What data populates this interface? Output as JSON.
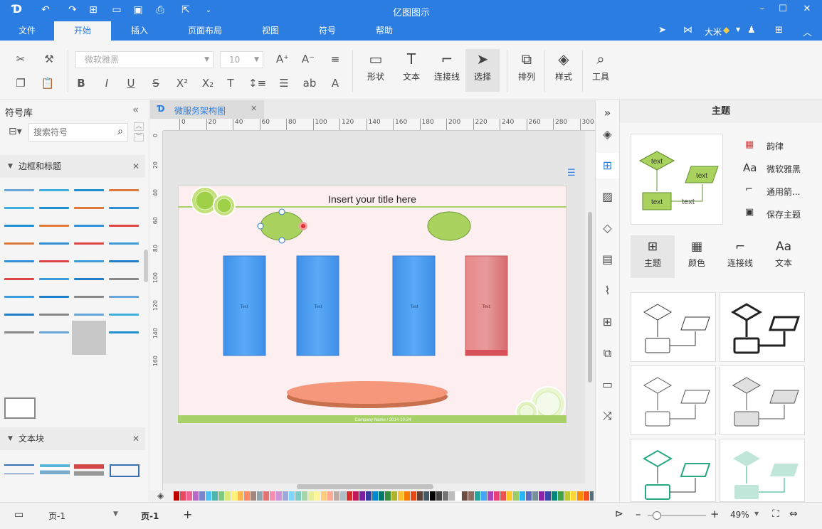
{
  "app": {
    "title": "亿图图示"
  },
  "menu": {
    "file": "文件",
    "tabs": [
      "开始",
      "插入",
      "页面布局",
      "视图",
      "符号",
      "帮助"
    ]
  },
  "user": {
    "name": "大米"
  },
  "ribbon": {
    "font_family": "微软雅黑",
    "font_size": "10",
    "shape_label": "形状",
    "text_label": "文本",
    "connector_label": "连接线",
    "select_label": "选择",
    "arrange_label": "排列",
    "style_label": "样式",
    "tools_label": "工具"
  },
  "library": {
    "title": "符号库",
    "search_placeholder": "搜索符号",
    "section1": "边框和标题",
    "section2": "文本块"
  },
  "document": {
    "tab_name": "微服务架构图",
    "ruler_h": [
      "0",
      "20",
      "40",
      "60",
      "80",
      "100",
      "120",
      "140",
      "160",
      "180",
      "200",
      "220",
      "240",
      "260",
      "280",
      "300"
    ],
    "ruler_v": [
      "0",
      "20",
      "40",
      "60",
      "80",
      "100",
      "120",
      "140",
      "160"
    ],
    "diagram_title": "Insert your title here",
    "box_text": "Text",
    "footer": "Company Name / 2014-10-24"
  },
  "theme_panel": {
    "title": "主题",
    "options": [
      "韵律",
      "微软雅黑",
      "通用箭...",
      "保存主题"
    ],
    "tabs": [
      "主题",
      "颜色",
      "连接线",
      "文本"
    ],
    "preview_text": "text"
  },
  "status": {
    "page_select": "页-1",
    "page_tab": "页-1",
    "zoom": "49%"
  },
  "colors": {
    "accent": "#2b7de1",
    "canvas_bg": "#fdeef0",
    "green": "#a8d16a",
    "blue_box": "#4a9ff5",
    "red_box": "#e07d80",
    "salmon": "#f4977a"
  }
}
